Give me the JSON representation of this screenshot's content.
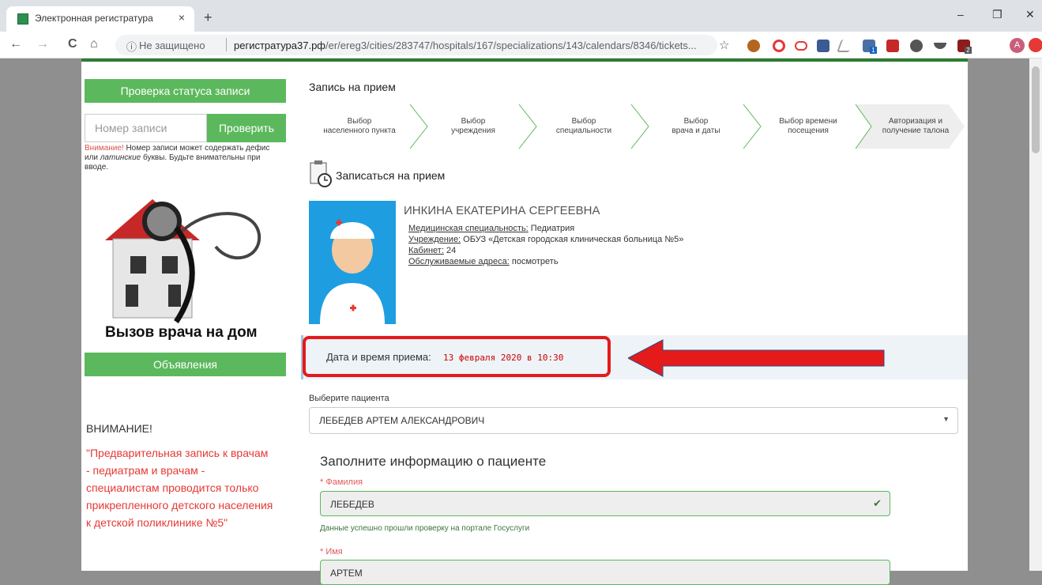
{
  "browser": {
    "tab_title": "Электронная регистратура",
    "tab_close": "×",
    "new_tab": "+",
    "win_min": "–",
    "win_max": "❐",
    "win_close": "✕",
    "nav_back": "←",
    "nav_forward": "→",
    "nav_reload": "C",
    "nav_home": "⌂",
    "security_icon": "ⓘ",
    "security_text": "Не защищено",
    "url_host": "регистратура37.рф",
    "url_path": "/er/ereg3/cities/283747/hospitals/167/specializations/143/calendars/8346/tickets...",
    "bookmark_icon": "☆",
    "profile_initial": "A",
    "ext_badge_1": "1",
    "ext_badge_2": "2"
  },
  "sidebar": {
    "status_check_title": "Проверка статуса записи",
    "record_placeholder": "Номер записи",
    "check_button": "Проверить",
    "warning_prefix": "Внимание!",
    "warning_text_1": " Номер записи может содержать дефис или ",
    "warning_italic": "латинские",
    "warning_text_2": " буквы. Будьте внимательны при вводе.",
    "house_caption": "Вызов врача на дом",
    "announcements_button": "Объявления",
    "attention_title": "ВНИМАНИЕ!",
    "attention_text": " \"Предварительная запись к врачам - педиатрам и врачам - специалистам проводится только прикрепленного детского населения к детской поликлинике №5\""
  },
  "main": {
    "heading": "Запись на прием",
    "steps": [
      {
        "line1": "Выбор",
        "line2": "населенного пункта"
      },
      {
        "line1": "Выбор",
        "line2": "учреждения"
      },
      {
        "line1": "Выбор",
        "line2": "специальности"
      },
      {
        "line1": "Выбор",
        "line2": "врача и даты"
      },
      {
        "line1": "Выбор времени",
        "line2": "посещения"
      },
      {
        "line1": "Авторизация и",
        "line2": "получение талона"
      }
    ],
    "book_title": "Записаться на прием",
    "doctor": {
      "name": "ИНКИНА ЕКАТЕРИНА СЕРГЕЕВНА",
      "spec_label": "Медицинская специальность:",
      "spec_value": " Педиатрия",
      "inst_label": "Учреждение:",
      "inst_value": " ОБУЗ «Детская городская клиническая больница №5»",
      "cab_label": "Кабинет:",
      "cab_value": " 24",
      "addr_label": "Обслуживаемые адреса:",
      "addr_link": " посмотреть"
    },
    "date_label": "Дата и время приема:",
    "date_value": "13 февраля 2020 в 10:30",
    "patient_label": "Выберите пациента",
    "patient_value": "ЛЕБЕДЕВ АРТЕМ АЛЕКСАНДРОВИЧ",
    "fill_heading": "Заполните информацию о пациенте",
    "surname_label": "* Фамилия",
    "surname_value": "ЛЕБЕДЕВ",
    "surname_ok": "Данные успешно прошли проверку на портале Госуслуги",
    "name_label": "* Имя",
    "name_value": "АРТЕМ",
    "check_mark": "✔",
    "caret": "▼"
  },
  "colors": {
    "green": "#5cb85c",
    "red": "#e51a1a",
    "accent_dark_green": "#2e7d32"
  }
}
